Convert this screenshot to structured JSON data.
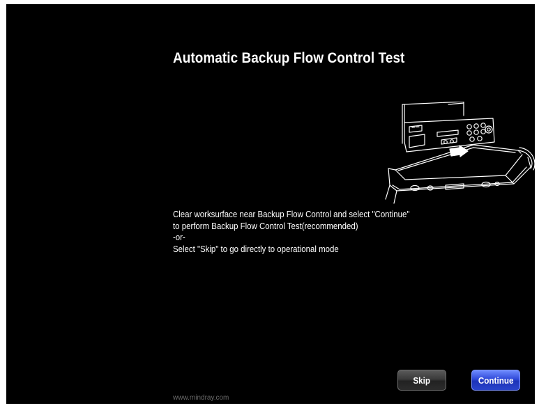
{
  "dialog": {
    "title": "Automatic Backup Flow Control Test",
    "instructions": {
      "line1": "Clear worksurface near Backup Flow Control and select \"Continue\"",
      "line2": "to perform Backup Flow Control Test(recommended)",
      "separator": "-or-",
      "line3": "Select \"Skip\" to go directly to operational mode"
    },
    "illustration": "worksurface-drawer-illustration"
  },
  "buttons": {
    "skip_label": "Skip",
    "continue_label": "Continue"
  },
  "footer": {
    "text": "www.mindray.com"
  },
  "colors": {
    "background": "#000000",
    "text": "#ffffff",
    "continue_button": "#2f49d8",
    "skip_button": "#3a3a3a",
    "footer_text": "#6a6a6a"
  }
}
